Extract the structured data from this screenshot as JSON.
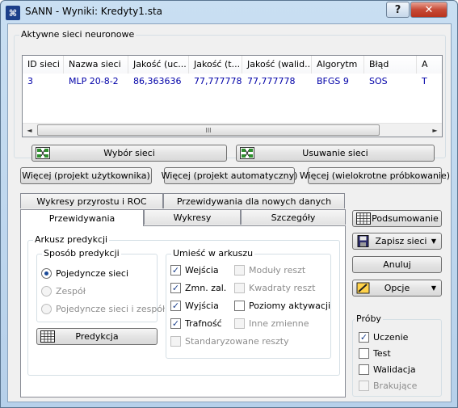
{
  "window": {
    "title": "SANN - Wyniki: Kredyty1.sta",
    "help_label": "?",
    "close_label": "✕"
  },
  "networks_group": {
    "label": "Aktywne sieci neuronowe",
    "columns": [
      "ID sieci",
      "Nazwa sieci",
      "Jakość (uc...",
      "Jakość (t...",
      "Jakość (walid...",
      "Algorytm",
      "Błąd",
      "A"
    ],
    "rows": [
      [
        "3",
        "MLP 20-8-2",
        "86,363636",
        "77,777778",
        "77,777778",
        "BFGS 9",
        "SOS",
        "T"
      ]
    ],
    "select_button": "Wybór sieci",
    "remove_button": "Usuwanie sieci",
    "scroll_left": "◄",
    "scroll_right": "►",
    "scroll_grip": "III"
  },
  "more_buttons": {
    "user": "Więcej (projekt użytkownika)",
    "auto": "Więcej (projekt automatyczny)",
    "subsampling": "Więcej (wielokrotne próbkowanie)"
  },
  "tabs": {
    "back_row": [
      "Wykresy przyrostu i ROC",
      "Przewidywania dla nowych danych"
    ],
    "front_row": [
      "Przewidywania",
      "Wykresy",
      "Szczegóły"
    ]
  },
  "prediction_sheet": {
    "label": "Arkusz predykcji",
    "method_group": {
      "label": "Sposób predykcji",
      "options": [
        "Pojedyncze sieci",
        "Zespół",
        "Pojedyncze sieci i zespół"
      ]
    },
    "place_group": {
      "label": "Umieść w arkuszu",
      "left_options": [
        {
          "label": "Wejścia",
          "checked": true
        },
        {
          "label": "Zmn. zal.",
          "checked": true
        },
        {
          "label": "Wyjścia",
          "checked": true
        },
        {
          "label": "Trafność",
          "checked": true
        }
      ],
      "right_options": [
        {
          "label": "Moduły reszt",
          "checked": false,
          "enabled": false
        },
        {
          "label": "Kwadraty reszt",
          "checked": false,
          "enabled": false
        },
        {
          "label": "Poziomy aktywacji",
          "checked": false,
          "enabled": true
        },
        {
          "label": "Inne zmienne",
          "checked": false,
          "enabled": false
        }
      ],
      "standardized": {
        "label": "Standaryzowane reszty",
        "checked": false,
        "enabled": false
      }
    },
    "predict_button": "Predykcja"
  },
  "right_panel": {
    "summary_button": "Podsumowanie",
    "save_button": "Zapisz sieci",
    "cancel_button": "Anuluj",
    "options_button": "Opcje",
    "samples_group": {
      "label": "Próby",
      "options": [
        {
          "label": "Uczenie",
          "checked": true,
          "enabled": true
        },
        {
          "label": "Test",
          "checked": false,
          "enabled": true
        },
        {
          "label": "Walidacja",
          "checked": false,
          "enabled": true
        },
        {
          "label": "Brakujące",
          "checked": false,
          "enabled": false
        }
      ]
    }
  }
}
